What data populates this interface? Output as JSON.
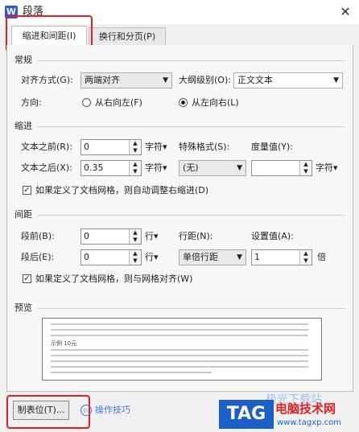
{
  "window": {
    "title": "段落",
    "app_icon_letter": "W",
    "close_symbol": "✕"
  },
  "tabs": [
    {
      "label": "缩进和间距(I)"
    },
    {
      "label": "换行和分页(P)"
    }
  ],
  "general": {
    "heading": "常规",
    "alignment_label": "对齐方式(G):",
    "alignment_value": "两端对齐",
    "outline_label": "大纲级别(O):",
    "outline_value": "正文文本",
    "direction_label": "方向:",
    "rtl_label": "从右向左(F)",
    "ltr_label": "从左向右(L)"
  },
  "indent": {
    "heading": "缩进",
    "before_label": "文本之前(R):",
    "before_value": "0",
    "before_unit": "字符",
    "after_label": "文本之后(X):",
    "after_value": "0.35",
    "after_unit": "字符",
    "special_label": "特殊格式(S):",
    "special_value": "(无)",
    "measure_label": "度量值(Y):",
    "measure_value": "",
    "measure_unit": "字符",
    "grid_checkbox_label": "如果定义了文档网格，则自动调整右缩进(D)"
  },
  "spacing": {
    "heading": "间距",
    "before_label": "段前(B):",
    "before_value": "0",
    "before_unit": "行",
    "after_label": "段后(E):",
    "after_value": "0",
    "after_unit": "行",
    "line_label": "行距(N):",
    "line_value": "单倍行距",
    "setting_label": "设置值(A):",
    "setting_value": "1",
    "setting_unit": "倍",
    "grid_checkbox_label": "如果定义了文档网格，则与网格对齐(W)"
  },
  "preview": {
    "heading": "预览",
    "sample_text": "示例 10元"
  },
  "footer": {
    "tabs_button": "制表位(T)...",
    "tips_label": "操作技巧",
    "tips_icon_glyph": "▷"
  },
  "watermark": {
    "logo": "TAG",
    "site_name": "电脑技术网",
    "url": "www.tagxp.com",
    "faint_text": "极光下载站"
  },
  "colors": {
    "highlight": "#e31e24",
    "link": "#3a7bd5",
    "logo_bg": "#1d5fc8"
  }
}
